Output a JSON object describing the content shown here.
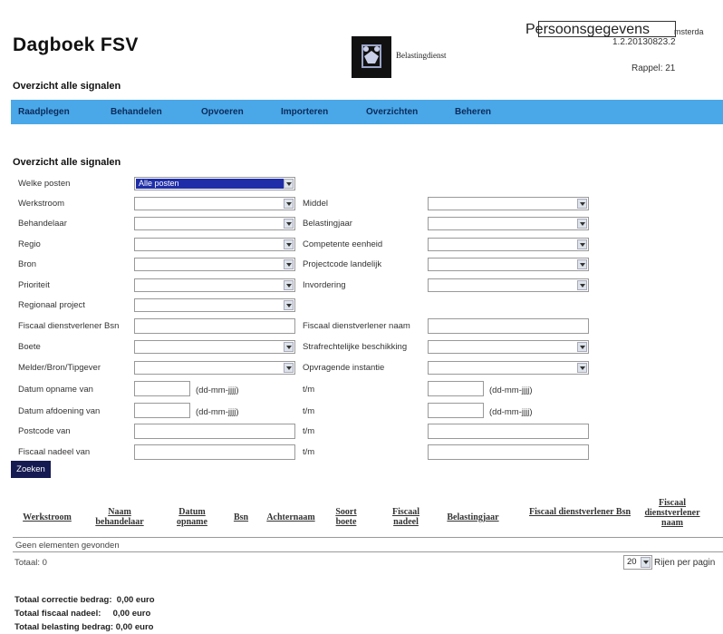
{
  "app": {
    "title": "Dagboek FSV",
    "brand": "Belastingdienst",
    "highlight": "Persoonsgegevens",
    "location": "msterda",
    "version": "1.2.20130823.2",
    "rappel": "Rappel: 21",
    "subtitle": "Overzicht alle signalen"
  },
  "nav": [
    "Raadplegen",
    "Behandelen",
    "Opvoeren",
    "Importeren",
    "Overzichten",
    "Beheren"
  ],
  "form": {
    "title": "Overzicht alle signalen",
    "left_labels": [
      "Welke posten",
      "Werkstroom",
      "Behandelaar",
      "Regio",
      "Bron",
      "Prioriteit",
      "Regionaal project",
      "Fiscaal dienstverlener Bsn",
      "Boete",
      "Melder/Bron/Tipgever",
      "Datum opname van",
      "Datum afdoening van",
      "Postcode van",
      "Fiscaal nadeel van"
    ],
    "right_labels": [
      "Middel",
      "Belastingjaar",
      "Competente eenheid",
      "Projectcode landelijk",
      "Invordering",
      "Fiscaal dienstverlener naam",
      "Strafrechtelijke beschikking",
      "Opvragende instantie",
      "t/m",
      "t/m",
      "t/m",
      "t/m"
    ],
    "welke_posten_value": "Alle posten",
    "date_format": "(dd-mm-jjjj)",
    "search_button": "Zoeken"
  },
  "table": {
    "headers": [
      "Werkstroom",
      "Naam behandelaar",
      "Datum opname",
      "Bsn",
      "Achternaam",
      "Soort boete",
      "Fiscaal nadeel",
      "Belastingjaar",
      "Fiscaal dienstverlener Bsn",
      "Fiscaal dienstverlener naam"
    ],
    "empty_text": "Geen elementen gevonden",
    "total": "Totaal: 0",
    "rows_per_page": "20",
    "rows_per_page_label": "Rijen per pagin"
  },
  "summary": [
    "Totaal correctie bedrag:  0,00 euro",
    "Totaal fiscaal nadeel:     0,00 euro",
    "Totaal belasting bedrag: 0,00 euro"
  ]
}
